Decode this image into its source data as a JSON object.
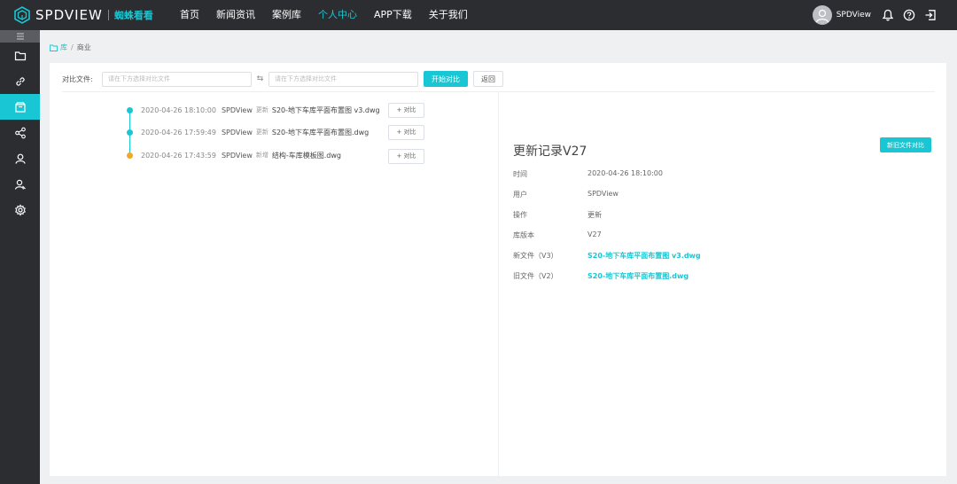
{
  "brand": {
    "name": "SPDVIEW",
    "subtitle": "蜘蛛看看"
  },
  "nav": [
    {
      "label": "首页",
      "active": false
    },
    {
      "label": "新闻资讯",
      "active": false
    },
    {
      "label": "案例库",
      "active": false
    },
    {
      "label": "个人中心",
      "active": true
    },
    {
      "label": "APP下载",
      "active": false
    },
    {
      "label": "关于我们",
      "active": false
    }
  ],
  "user": {
    "name": "SPDView"
  },
  "header_icons": [
    "bell-icon",
    "help-icon",
    "logout-icon"
  ],
  "sidebar": {
    "toggle_icon": "menu-icon",
    "items": [
      {
        "icon": "folder-icon",
        "active": false
      },
      {
        "icon": "link-icon",
        "active": false
      },
      {
        "icon": "box-icon",
        "active": true
      },
      {
        "icon": "share-icon",
        "active": false
      },
      {
        "icon": "user-icon",
        "active": false
      },
      {
        "icon": "users-icon",
        "active": false
      },
      {
        "icon": "gear-icon",
        "active": false
      }
    ]
  },
  "breadcrumb": {
    "root": "库",
    "current": "商业"
  },
  "compare": {
    "label": "对比文件:",
    "placeholder_left": "请在下方选择对比文件",
    "placeholder_right": "请在下方选择对比文件",
    "swap_symbol": "⇆",
    "start_button": "开始对比",
    "back_button": "返回"
  },
  "timeline": [
    {
      "time": "2020-04-26 18:10:00",
      "user": "SPDView",
      "action": "更新",
      "file": "S20-地下车库平面布置图 v3.dwg",
      "compare_button": "+ 对比",
      "dot_color": "#19c6d3"
    },
    {
      "time": "2020-04-26 17:59:49",
      "user": "SPDView",
      "action": "更新",
      "file": "S20-地下车库平面布置图.dwg",
      "compare_button": "+ 对比",
      "dot_color": "#19c6d3"
    },
    {
      "time": "2020-04-26 17:43:59",
      "user": "SPDView",
      "action": "新增",
      "file": "结构-车库模板图.dwg",
      "compare_button": "+ 对比",
      "dot_color": "#f5a623"
    }
  ],
  "detail": {
    "title": "更新记录V27",
    "compare_old_new_button": "新旧文件对比",
    "fields": [
      {
        "label": "时间",
        "value": "2020-04-26 18:10:00",
        "link": false
      },
      {
        "label": "用户",
        "value": "SPDView",
        "link": false
      },
      {
        "label": "操作",
        "value": "更新",
        "link": false
      },
      {
        "label": "库版本",
        "value": "V27",
        "link": false
      },
      {
        "label": "新文件（V3）",
        "value": "S20-地下车库平面布置图 v3.dwg",
        "link": true
      },
      {
        "label": "旧文件（V2）",
        "value": "S20-地下车库平面布置图.dwg",
        "link": true
      }
    ]
  }
}
